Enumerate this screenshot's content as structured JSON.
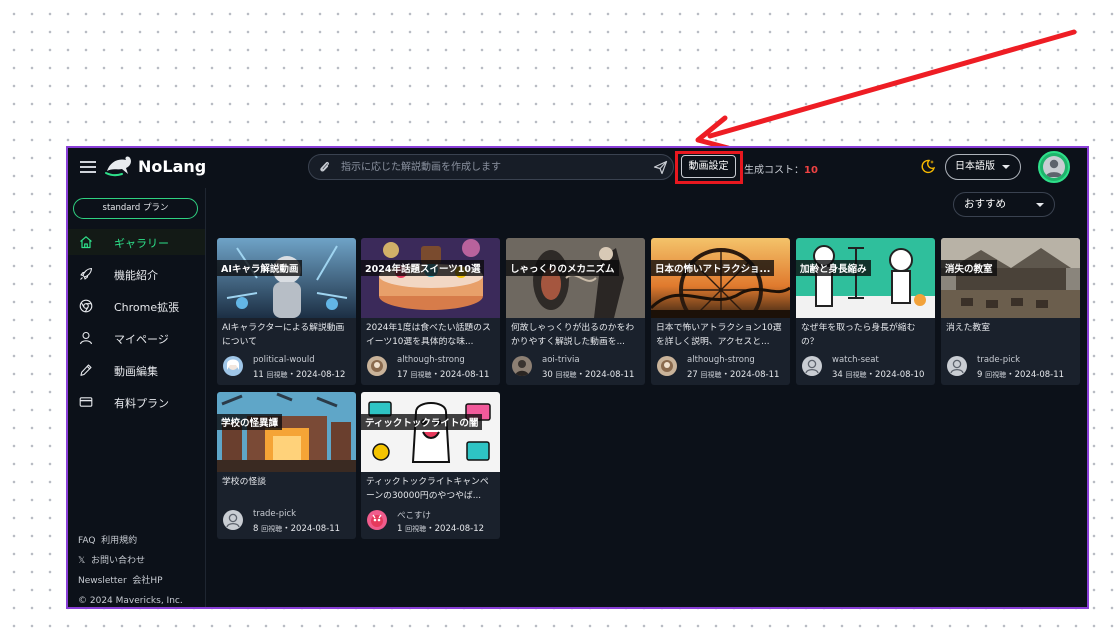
{
  "app": {
    "brand": "NoLang"
  },
  "header": {
    "search_placeholder": "指示に応じた解説動画を作成します",
    "video_settings_label": "動画設定",
    "cost_label": "生成コスト：",
    "cost_value": "10",
    "language": "日本語版"
  },
  "sidebar": {
    "plan_label": "standard プラン",
    "items": [
      {
        "label": "ギャラリー",
        "icon": "home-icon",
        "active": true
      },
      {
        "label": "機能紹介",
        "icon": "rocket-icon",
        "active": false
      },
      {
        "label": "Chrome拡張",
        "icon": "chrome-icon",
        "active": false
      },
      {
        "label": "マイページ",
        "icon": "user-icon",
        "active": false
      },
      {
        "label": "動画編集",
        "icon": "pencil-icon",
        "active": false
      },
      {
        "label": "有料プラン",
        "icon": "credit-card-icon",
        "active": false
      }
    ],
    "footer": {
      "faq": "FAQ",
      "terms": "利用規約",
      "x": "𝕏",
      "contact": "お問い合わせ",
      "newsletter": "Newsletter",
      "company": "会社HP",
      "copyright": "© 2024 Mavericks, Inc."
    }
  },
  "main": {
    "sort_label": "おすすめ",
    "view_unit": "回視聴",
    "separator": "・",
    "videos": [
      {
        "thumb_title": "AIキャラ解説動画",
        "title": "AIキャラクターによる解説動画について",
        "author": "political-would",
        "views": "11",
        "date": "2024-08-12"
      },
      {
        "thumb_title": "2024年話題スイーツ10選",
        "title": "2024年1度は食べたい話題のスイーツ10選を具体的な味...",
        "author": "although-strong",
        "views": "17",
        "date": "2024-08-11"
      },
      {
        "thumb_title": "しゃっくりのメカニズム",
        "title": "何故しゃっくりが出るのかをわかりやすく解説した動画を...",
        "author": "aoi-trivia",
        "views": "30",
        "date": "2024-08-11"
      },
      {
        "thumb_title": "日本の怖いアトラクショ...",
        "title": "日本で怖いアトラクション10選を詳しく説明、アクセスと...",
        "author": "although-strong",
        "views": "27",
        "date": "2024-08-11"
      },
      {
        "thumb_title": "加齢と身長縮み",
        "title": "なぜ年を取ったら身長が縮むの？",
        "author": "watch-seat",
        "views": "34",
        "date": "2024-08-10"
      },
      {
        "thumb_title": "消失の教室",
        "title": "消えた教室",
        "author": "trade-pick",
        "views": "9",
        "date": "2024-08-11"
      },
      {
        "thumb_title": "学校の怪異譚",
        "title": "学校の怪談",
        "author": "trade-pick",
        "views": "8",
        "date": "2024-08-11"
      },
      {
        "thumb_title": "ティックトックライトの闇",
        "title": "ティックトックライトキャンペーンの30000円のやつやば...",
        "author": "ぺこすけ",
        "views": "1",
        "date": "2024-08-12"
      }
    ]
  },
  "colors": {
    "accent": "#2ee08a",
    "frame": "#8a3fd8",
    "highlight": "#e8181f",
    "background": "#0c1119",
    "card": "#1a212c"
  }
}
